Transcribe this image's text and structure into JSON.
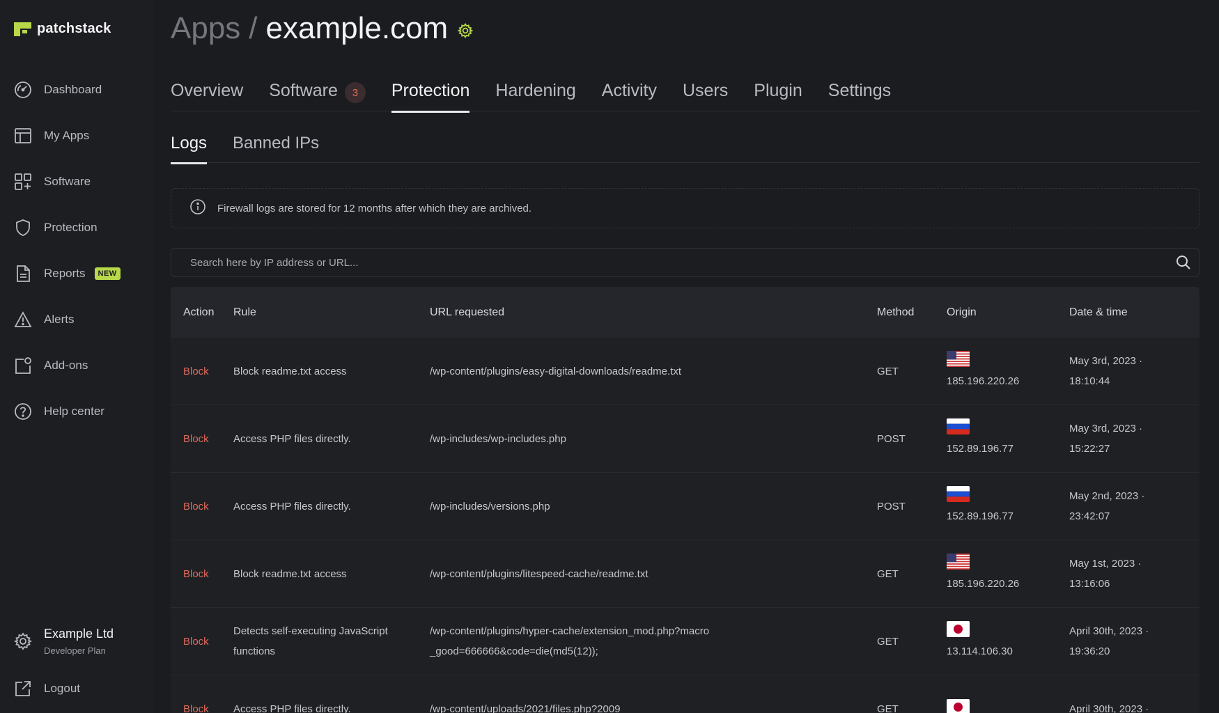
{
  "brand": {
    "name": "patchstack",
    "accent": "#b8d84a"
  },
  "sidebar": {
    "items": [
      {
        "label": "Dashboard",
        "icon": "gauge-icon"
      },
      {
        "label": "My Apps",
        "icon": "layout-icon"
      },
      {
        "label": "Software",
        "icon": "grid-plus-icon"
      },
      {
        "label": "Protection",
        "icon": "shield-icon"
      },
      {
        "label": "Reports",
        "icon": "document-icon",
        "badge": "NEW"
      },
      {
        "label": "Alerts",
        "icon": "warning-icon"
      },
      {
        "label": "Add-ons",
        "icon": "addons-icon"
      },
      {
        "label": "Help center",
        "icon": "help-icon"
      }
    ],
    "account": {
      "name": "Example Ltd",
      "plan": "Developer Plan"
    },
    "logout_label": "Logout"
  },
  "header": {
    "parent": "Apps",
    "separator": "/",
    "current": "example.com"
  },
  "tabs": [
    {
      "label": "Overview"
    },
    {
      "label": "Software",
      "count": "3"
    },
    {
      "label": "Protection",
      "active": true
    },
    {
      "label": "Hardening"
    },
    {
      "label": "Activity"
    },
    {
      "label": "Users"
    },
    {
      "label": "Plugin"
    },
    {
      "label": "Settings"
    }
  ],
  "subtabs": [
    {
      "label": "Logs",
      "active": true
    },
    {
      "label": "Banned IPs"
    }
  ],
  "notice": {
    "text": "Firewall logs are stored for 12 months after which they are archived."
  },
  "search": {
    "placeholder": "Search here by IP address or URL..."
  },
  "table": {
    "headers": [
      "Action",
      "Rule",
      "URL requested",
      "Method",
      "Origin",
      "Date & time"
    ],
    "rows": [
      {
        "action": "Block",
        "rule": "Block readme.txt access",
        "url": "/wp-content/plugins/easy-digital-downloads/readme.txt",
        "method": "GET",
        "country": "us",
        "ip": "185.196.220.26",
        "date": "May 3rd, 2023 ·",
        "time": "18:10:44"
      },
      {
        "action": "Block",
        "rule": "Access PHP files directly.",
        "url": "/wp-includes/wp-includes.php",
        "method": "POST",
        "country": "ru",
        "ip": "152.89.196.77",
        "date": "May 3rd, 2023 ·",
        "time": "15:22:27"
      },
      {
        "action": "Block",
        "rule": "Access PHP files directly.",
        "url": "/wp-includes/versions.php",
        "method": "POST",
        "country": "ru",
        "ip": "152.89.196.77",
        "date": "May 2nd, 2023 ·",
        "time": "23:42:07"
      },
      {
        "action": "Block",
        "rule": "Block readme.txt access",
        "url": "/wp-content/plugins/litespeed-cache/readme.txt",
        "method": "GET",
        "country": "us",
        "ip": "185.196.220.26",
        "date": "May 1st, 2023 ·",
        "time": "13:16:06"
      },
      {
        "action": "Block",
        "rule": "Detects self-executing JavaScript functions",
        "url": "/wp-content/plugins/hyper-cache/extension_mod.php?macro_good=666666&code=die(md5(12));",
        "method": "GET",
        "country": "jp",
        "ip": "13.114.106.30",
        "date": "April 30th, 2023 ·",
        "time": "19:36:20"
      },
      {
        "action": "Block",
        "rule": "Access PHP files directly.",
        "url": "/wp-content/uploads/2021/files.php?2009",
        "method": "GET",
        "country": "jp",
        "ip": "",
        "date": "April 30th, 2023 ·",
        "time": ""
      }
    ]
  },
  "colors": {
    "background": "#1b1c20",
    "block": "#e06a5c",
    "badge": "#b8d84a"
  }
}
